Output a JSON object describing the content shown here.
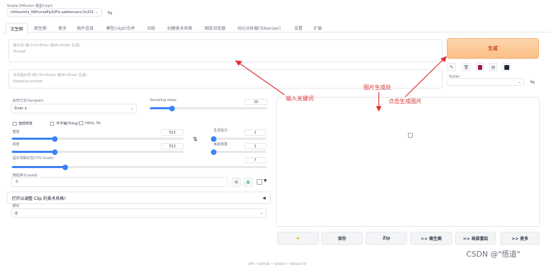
{
  "model": {
    "label": "Stable Diffusion 模型(ckpt)",
    "value": "chilloutmix_NiPrunedFp32Fix.safetensors [fc251"
  },
  "tabs": [
    {
      "label": "文生图",
      "active": true
    },
    {
      "label": "图生图"
    },
    {
      "label": "更多"
    },
    {
      "label": "图片信息"
    },
    {
      "label": "模型(ckpt)合并"
    },
    {
      "label": "训练"
    },
    {
      "label": "创建美术风格"
    },
    {
      "label": "图库浏览器"
    },
    {
      "label": "词元分析器(Tokenizer)"
    },
    {
      "label": "设置"
    },
    {
      "label": "扩展"
    }
  ],
  "prompt": {
    "placeholder": "提示词 (按 Ctrl+Enter 或Alt+Enter 生成)",
    "sub": "Prompt"
  },
  "negative_prompt": {
    "placeholder": "反向提示词 (按 Ctrl+Enter 或Alt+Enter 生成)",
    "sub": "Negative prompt"
  },
  "generate": {
    "label": "生成"
  },
  "styles": {
    "label": "Styles"
  },
  "sampler": {
    "label": "采样方法(Sampler)",
    "value": "Euler a"
  },
  "steps": {
    "label": "Sampling steps",
    "value": "20",
    "fraction": 0.19
  },
  "checkboxes": [
    "面部修复",
    "可平铺(Tiling)",
    "Hires. fix"
  ],
  "width": {
    "label": "宽度",
    "value": "512",
    "fraction": 0.25
  },
  "height": {
    "label": "高度",
    "value": "512",
    "fraction": 0.25
  },
  "batch_count": {
    "label": "生成批次",
    "value": "1",
    "fraction": 0.0
  },
  "batch_size": {
    "label": "每批数量",
    "value": "1",
    "fraction": 0.0
  },
  "cfg": {
    "label": "提示词相关性(CFG Scale)",
    "value": "7",
    "fraction": 0.21
  },
  "seed": {
    "label": "随机种子(seed)",
    "value": "-1"
  },
  "script_section": {
    "title": "打开以调整 Clip 的美术风格!",
    "script_label": "脚本",
    "script_value": "无"
  },
  "buttons": {
    "save": "保存",
    "zip": "Zip",
    "to_img2img": ">> 图生图",
    "to_inpaint": ">> 局部重绘",
    "more": ">> 更多"
  },
  "annotations": {
    "input_keywords": "输入关键词",
    "image_area": "图片生成处",
    "click_generate": "点击生成图片"
  },
  "footer": "API • Github • Gradio • Reload UI",
  "watermark": "CSDN @\"悟道\"",
  "colors": {
    "accent": "#3b82f6",
    "generate_bg": "#fbbf85",
    "generate_text": "#c2410c",
    "annotation": "#e03131"
  }
}
